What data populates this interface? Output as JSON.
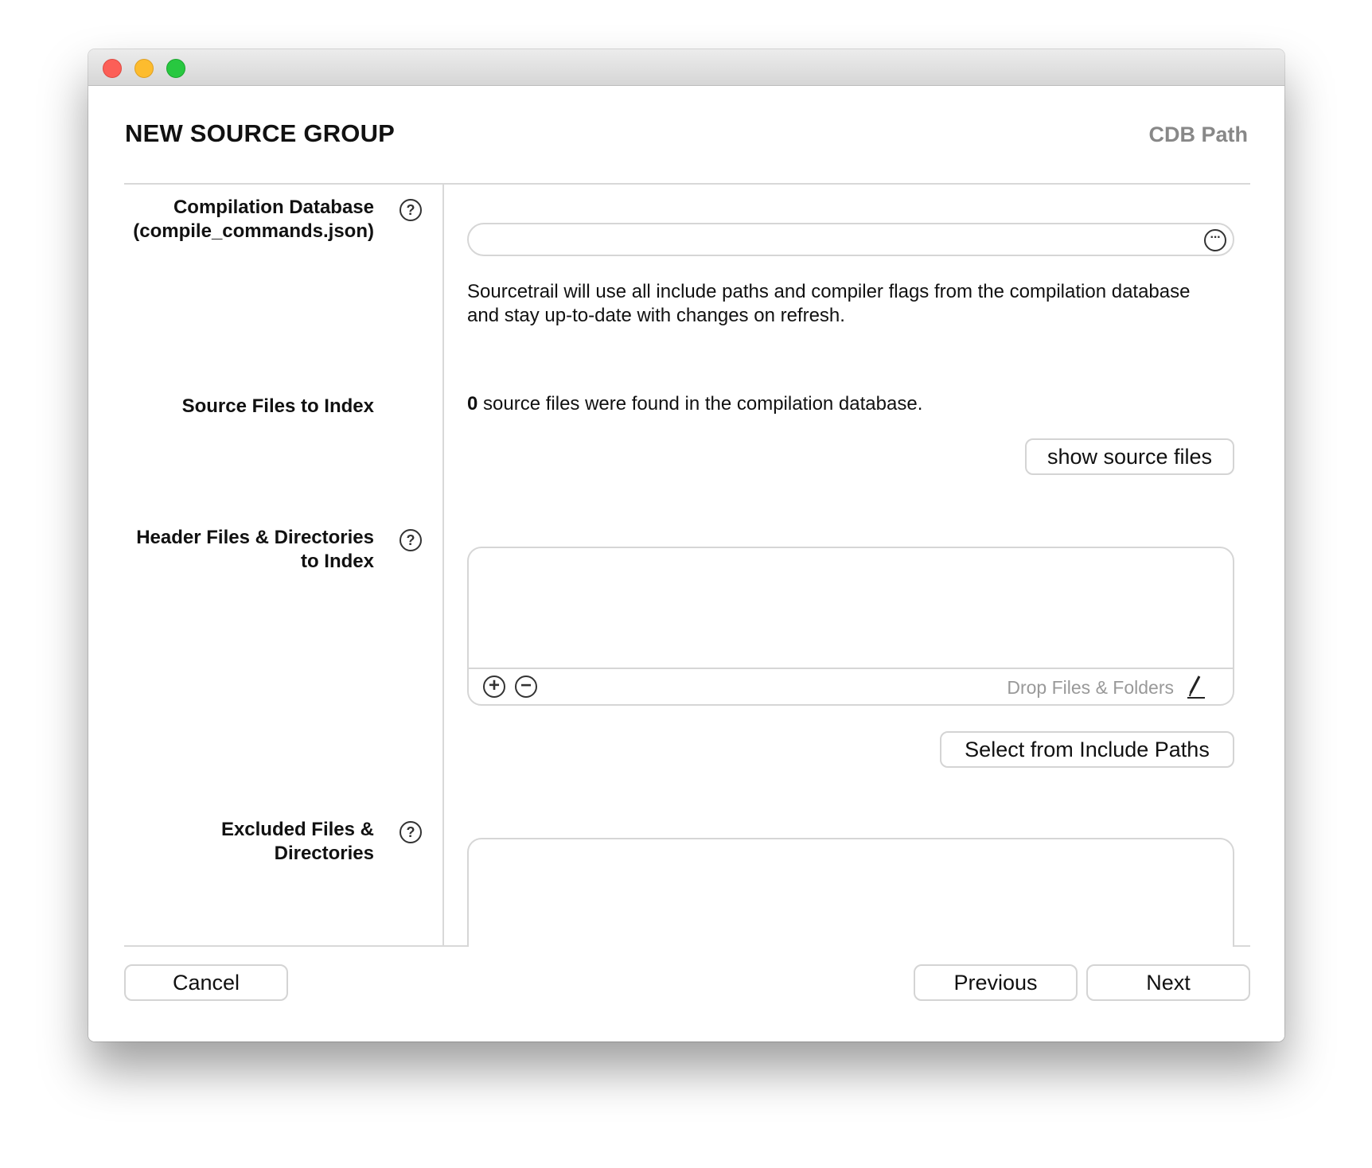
{
  "window": {
    "heading": "NEW SOURCE GROUP",
    "step": "CDB Path"
  },
  "compilation_database": {
    "label_line1": "Compilation Database",
    "label_line2": "(compile_commands.json)",
    "help_icon": "question-circle-icon",
    "path_value": "",
    "browse_icon": "ellipsis-circle-icon",
    "description": "Sourcetrail will use all include paths and compiler flags from the compilation database and stay up-to-date with changes on refresh."
  },
  "source_files": {
    "label": "Source Files to Index",
    "count": "0",
    "found_text": " source files were found in the compilation database.",
    "show_button": "show source files"
  },
  "header_files": {
    "label_line1": "Header Files & Directories",
    "label_line2": "to Index",
    "help_icon": "question-circle-icon",
    "add_icon": "plus-circle-icon",
    "remove_icon": "minus-circle-icon",
    "drop_text": "Drop Files & Folders",
    "edit_icon": "pencil-icon",
    "select_button": "Select from Include Paths"
  },
  "excluded_files": {
    "label_line1": "Excluded Files &",
    "label_line2": "Directories",
    "help_icon": "question-circle-icon"
  },
  "footer": {
    "cancel": "Cancel",
    "previous": "Previous",
    "next": "Next"
  }
}
